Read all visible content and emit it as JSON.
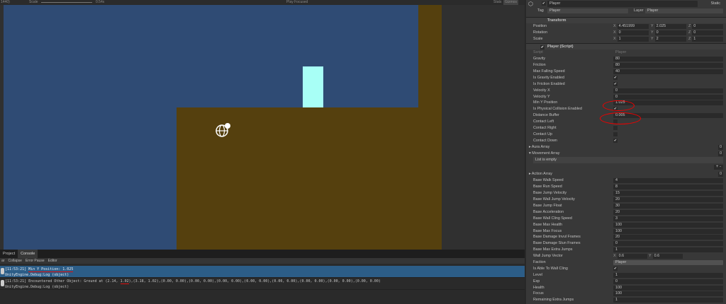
{
  "toolbar": {
    "resolution": "1440)",
    "scale_label": "Scale",
    "scale_value": "0.54x",
    "play_mode": "Play Focused",
    "stats": "Stats",
    "gizmos": "Gizmos"
  },
  "console": {
    "tabs": [
      "Project",
      "Console"
    ],
    "toolbar": [
      "ar",
      "Collapse",
      "Error Pause",
      "Editor"
    ],
    "logs": [
      {
        "time": "[11:53:21]",
        "msg": "Min Y Position: 1.025",
        "trace": "UnityEngine.Debug:Log (object)"
      },
      {
        "time": "[11:53:21]",
        "msg_pre": "Encountered Other Object: Ground at (2.14, ",
        "msg_hl": "1.02",
        "msg_post": "),(3.18, 1.02),(0.00, 0.00),(0.00, 0.00),(0.00, 0.00),(0.00, 0.00),(0.00, 0.00),(0.00, 0.00),(0.00, 0.00),(0.00, 0.00)",
        "trace": "UnityEngine.Debug:Log (object)"
      }
    ]
  },
  "inspector": {
    "name": "Player",
    "static": "Static",
    "tag_label": "Tag",
    "tag": "Player",
    "layer_label": "Layer",
    "layer": "Player",
    "transform": {
      "title": "Transform",
      "position": {
        "label": "Position",
        "x": "4.451999",
        "y": "2.025",
        "z": "0"
      },
      "rotation": {
        "label": "Rotation",
        "x": "0",
        "y": "0",
        "z": "0"
      },
      "scale": {
        "label": "Scale",
        "x": "1",
        "y": "2",
        "z": "1"
      }
    },
    "script_title": "Player (Script)",
    "script_label": "Script",
    "script_value": "Player",
    "fields1": [
      {
        "l": "Gravity",
        "v": "80"
      },
      {
        "l": "Friction",
        "v": "80"
      },
      {
        "l": "Max Falling Speed",
        "v": "40"
      },
      {
        "l": "Is Gravity Enabled",
        "c": "✔"
      },
      {
        "l": "Is Friction Enabled",
        "c": "✔"
      },
      {
        "l": "Velocity X",
        "v": "0"
      },
      {
        "l": "Velocity Y",
        "v": "0"
      },
      {
        "l": "Min Y Position",
        "v": "1.025"
      },
      {
        "l": "Is Physical Collision Enabled",
        "c": "✔"
      },
      {
        "l": "Distance Buffer",
        "v": "0.005"
      },
      {
        "l": "Contact Left",
        "c": ""
      },
      {
        "l": "Contact Right",
        "c": ""
      },
      {
        "l": "Contact Up",
        "c": ""
      },
      {
        "l": "Contact Down",
        "c": "✔"
      }
    ],
    "aura": {
      "l": "Aura Array",
      "n": "0"
    },
    "movement": {
      "l": "Movement Array",
      "n": "0"
    },
    "list_empty": "List is empty",
    "action": {
      "l": "Action Array",
      "n": "0"
    },
    "fields2": [
      {
        "l": "Base Walk Speed",
        "v": "4"
      },
      {
        "l": "Base Run Speed",
        "v": "8"
      },
      {
        "l": "Base Jump Velocity",
        "v": "15"
      },
      {
        "l": "Base Wall Jump Velocity",
        "v": "20"
      },
      {
        "l": "Base Jump Float",
        "v": "30"
      },
      {
        "l": "Base Acceleration",
        "v": "20"
      },
      {
        "l": "Base Wall Cling Speed",
        "v": "3"
      },
      {
        "l": "Base Max Health",
        "v": "100"
      },
      {
        "l": "Base Max Focus",
        "v": "100"
      },
      {
        "l": "Base Damage Invul Frames",
        "v": "20"
      },
      {
        "l": "Base Damage Stun Frames",
        "v": "0"
      },
      {
        "l": "Base Max Extra Jumps",
        "v": "1"
      }
    ],
    "wall_jump": {
      "l": "Wall Jump Vector",
      "x": "0.6",
      "y": "0.6"
    },
    "faction": {
      "l": "Faction",
      "v": "Player"
    },
    "fields3": [
      {
        "l": "Is Able To Wall Cling",
        "c": "✔"
      },
      {
        "l": "Level",
        "v": "1"
      },
      {
        "l": "Exp",
        "v": "0"
      },
      {
        "l": "Health",
        "v": "100"
      },
      {
        "l": "Focus",
        "v": "100"
      },
      {
        "l": "Remaining Extra Jumps",
        "v": "1"
      }
    ]
  }
}
